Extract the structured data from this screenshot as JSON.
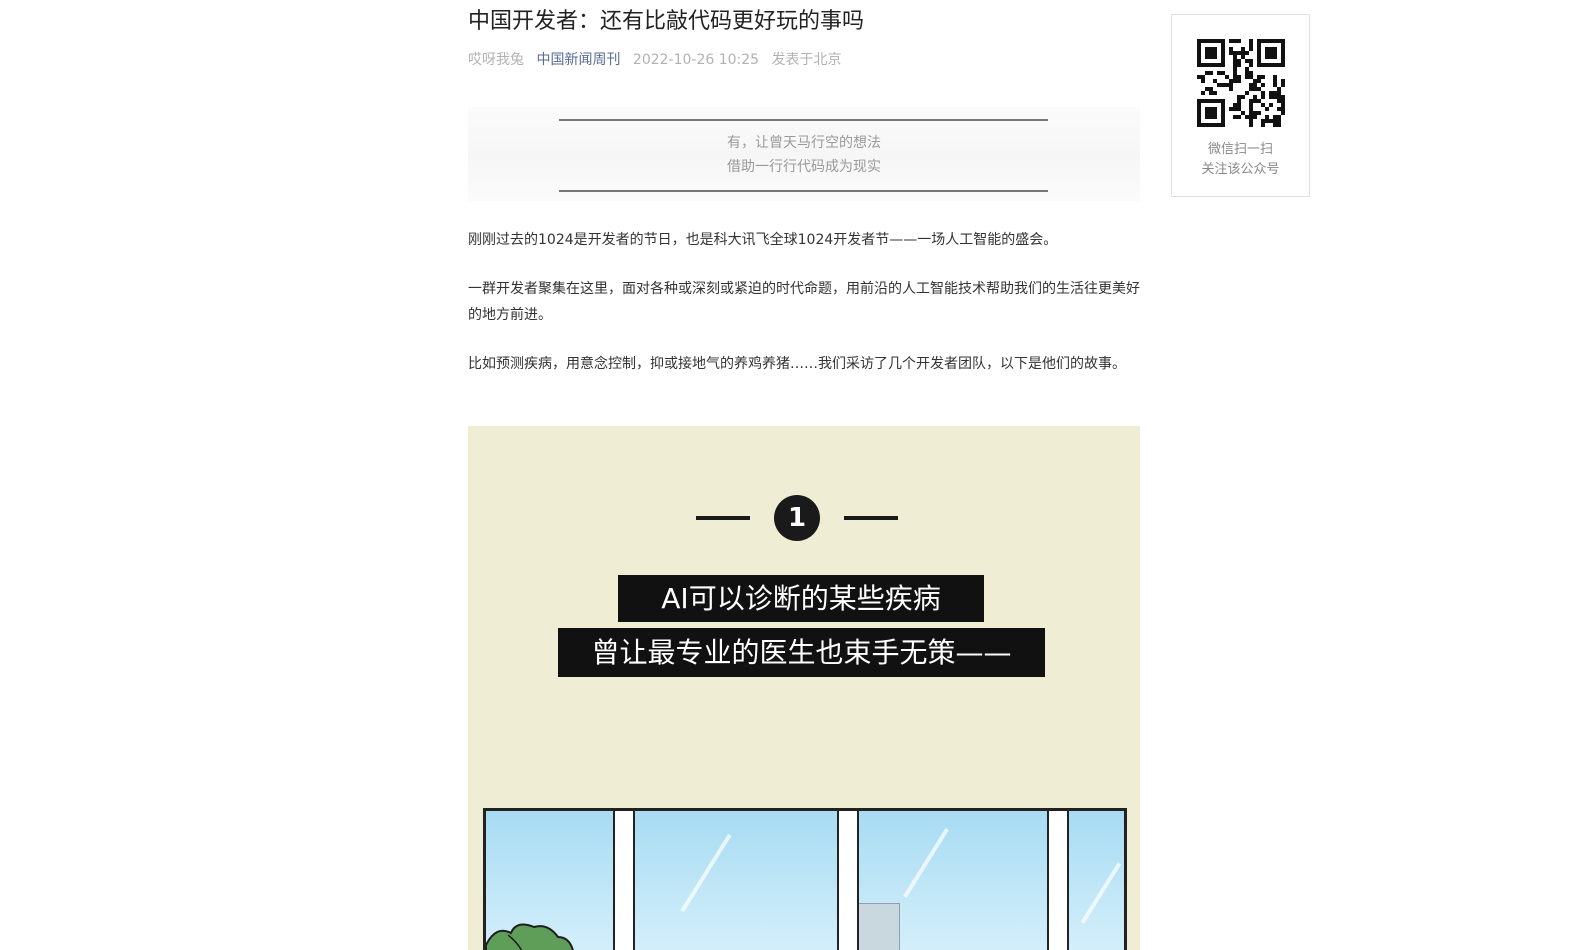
{
  "article": {
    "title": "中国开发者：还有比敲代码更好玩的事吗",
    "author": "哎呀我兔",
    "account": "中国新闻周刊",
    "datetime": "2022-10-26 10:25",
    "location": "发表于北京",
    "quote_lines": [
      "有，让曾天马行空的想法",
      "借助一行行代码成为现实"
    ],
    "paragraphs": [
      "刚刚过去的1024是开发者的节日，也是科大讯飞全球1024开发者节——一场人工智能的盛会。",
      "一群开发者聚集在这里，面对各种或深刻或紧迫的时代命题，用前沿的人工智能技术帮助我们的生活往更美好的地方前进。",
      "比如预测疾病，用意念控制，抑或接地气的养鸡养猪……我们采访了几个开发者团队，以下是他们的故事。"
    ],
    "illustration": {
      "number": "1",
      "caption_lines": [
        "AI可以诊断的某些疾病",
        "曾让最专业的医生也束手无策——"
      ],
      "background": "#efedd4"
    }
  },
  "qr_card": {
    "lines": [
      "微信扫一扫",
      "关注该公众号"
    ]
  }
}
